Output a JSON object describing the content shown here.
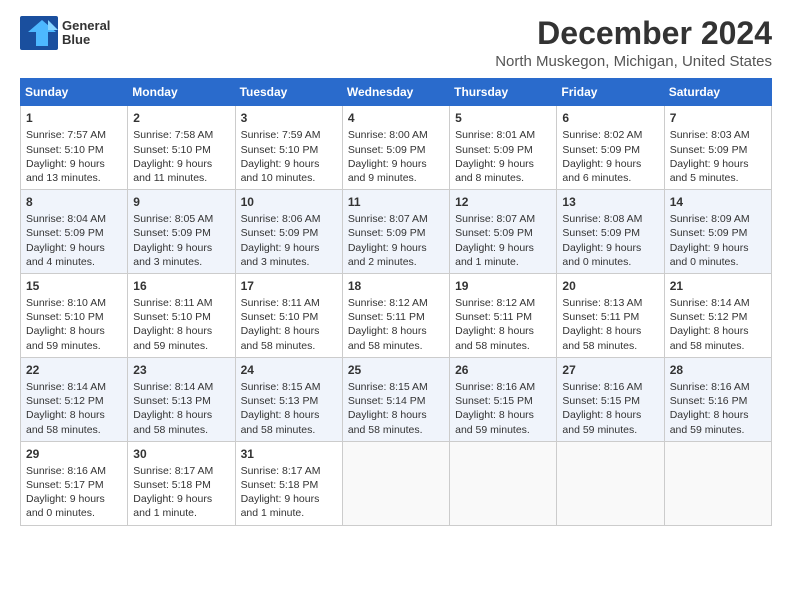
{
  "header": {
    "logo_line1": "General",
    "logo_line2": "Blue",
    "month_title": "December 2024",
    "location": "North Muskegon, Michigan, United States"
  },
  "weekdays": [
    "Sunday",
    "Monday",
    "Tuesday",
    "Wednesday",
    "Thursday",
    "Friday",
    "Saturday"
  ],
  "weeks": [
    [
      {
        "day": "1",
        "lines": [
          "Sunrise: 7:57 AM",
          "Sunset: 5:10 PM",
          "Daylight: 9 hours",
          "and 13 minutes."
        ]
      },
      {
        "day": "2",
        "lines": [
          "Sunrise: 7:58 AM",
          "Sunset: 5:10 PM",
          "Daylight: 9 hours",
          "and 11 minutes."
        ]
      },
      {
        "day": "3",
        "lines": [
          "Sunrise: 7:59 AM",
          "Sunset: 5:10 PM",
          "Daylight: 9 hours",
          "and 10 minutes."
        ]
      },
      {
        "day": "4",
        "lines": [
          "Sunrise: 8:00 AM",
          "Sunset: 5:09 PM",
          "Daylight: 9 hours",
          "and 9 minutes."
        ]
      },
      {
        "day": "5",
        "lines": [
          "Sunrise: 8:01 AM",
          "Sunset: 5:09 PM",
          "Daylight: 9 hours",
          "and 8 minutes."
        ]
      },
      {
        "day": "6",
        "lines": [
          "Sunrise: 8:02 AM",
          "Sunset: 5:09 PM",
          "Daylight: 9 hours",
          "and 6 minutes."
        ]
      },
      {
        "day": "7",
        "lines": [
          "Sunrise: 8:03 AM",
          "Sunset: 5:09 PM",
          "Daylight: 9 hours",
          "and 5 minutes."
        ]
      }
    ],
    [
      {
        "day": "8",
        "lines": [
          "Sunrise: 8:04 AM",
          "Sunset: 5:09 PM",
          "Daylight: 9 hours",
          "and 4 minutes."
        ]
      },
      {
        "day": "9",
        "lines": [
          "Sunrise: 8:05 AM",
          "Sunset: 5:09 PM",
          "Daylight: 9 hours",
          "and 3 minutes."
        ]
      },
      {
        "day": "10",
        "lines": [
          "Sunrise: 8:06 AM",
          "Sunset: 5:09 PM",
          "Daylight: 9 hours",
          "and 3 minutes."
        ]
      },
      {
        "day": "11",
        "lines": [
          "Sunrise: 8:07 AM",
          "Sunset: 5:09 PM",
          "Daylight: 9 hours",
          "and 2 minutes."
        ]
      },
      {
        "day": "12",
        "lines": [
          "Sunrise: 8:07 AM",
          "Sunset: 5:09 PM",
          "Daylight: 9 hours",
          "and 1 minute."
        ]
      },
      {
        "day": "13",
        "lines": [
          "Sunrise: 8:08 AM",
          "Sunset: 5:09 PM",
          "Daylight: 9 hours",
          "and 0 minutes."
        ]
      },
      {
        "day": "14",
        "lines": [
          "Sunrise: 8:09 AM",
          "Sunset: 5:09 PM",
          "Daylight: 9 hours",
          "and 0 minutes."
        ]
      }
    ],
    [
      {
        "day": "15",
        "lines": [
          "Sunrise: 8:10 AM",
          "Sunset: 5:10 PM",
          "Daylight: 8 hours",
          "and 59 minutes."
        ]
      },
      {
        "day": "16",
        "lines": [
          "Sunrise: 8:11 AM",
          "Sunset: 5:10 PM",
          "Daylight: 8 hours",
          "and 59 minutes."
        ]
      },
      {
        "day": "17",
        "lines": [
          "Sunrise: 8:11 AM",
          "Sunset: 5:10 PM",
          "Daylight: 8 hours",
          "and 58 minutes."
        ]
      },
      {
        "day": "18",
        "lines": [
          "Sunrise: 8:12 AM",
          "Sunset: 5:11 PM",
          "Daylight: 8 hours",
          "and 58 minutes."
        ]
      },
      {
        "day": "19",
        "lines": [
          "Sunrise: 8:12 AM",
          "Sunset: 5:11 PM",
          "Daylight: 8 hours",
          "and 58 minutes."
        ]
      },
      {
        "day": "20",
        "lines": [
          "Sunrise: 8:13 AM",
          "Sunset: 5:11 PM",
          "Daylight: 8 hours",
          "and 58 minutes."
        ]
      },
      {
        "day": "21",
        "lines": [
          "Sunrise: 8:14 AM",
          "Sunset: 5:12 PM",
          "Daylight: 8 hours",
          "and 58 minutes."
        ]
      }
    ],
    [
      {
        "day": "22",
        "lines": [
          "Sunrise: 8:14 AM",
          "Sunset: 5:12 PM",
          "Daylight: 8 hours",
          "and 58 minutes."
        ]
      },
      {
        "day": "23",
        "lines": [
          "Sunrise: 8:14 AM",
          "Sunset: 5:13 PM",
          "Daylight: 8 hours",
          "and 58 minutes."
        ]
      },
      {
        "day": "24",
        "lines": [
          "Sunrise: 8:15 AM",
          "Sunset: 5:13 PM",
          "Daylight: 8 hours",
          "and 58 minutes."
        ]
      },
      {
        "day": "25",
        "lines": [
          "Sunrise: 8:15 AM",
          "Sunset: 5:14 PM",
          "Daylight: 8 hours",
          "and 58 minutes."
        ]
      },
      {
        "day": "26",
        "lines": [
          "Sunrise: 8:16 AM",
          "Sunset: 5:15 PM",
          "Daylight: 8 hours",
          "and 59 minutes."
        ]
      },
      {
        "day": "27",
        "lines": [
          "Sunrise: 8:16 AM",
          "Sunset: 5:15 PM",
          "Daylight: 8 hours",
          "and 59 minutes."
        ]
      },
      {
        "day": "28",
        "lines": [
          "Sunrise: 8:16 AM",
          "Sunset: 5:16 PM",
          "Daylight: 8 hours",
          "and 59 minutes."
        ]
      }
    ],
    [
      {
        "day": "29",
        "lines": [
          "Sunrise: 8:16 AM",
          "Sunset: 5:17 PM",
          "Daylight: 9 hours",
          "and 0 minutes."
        ]
      },
      {
        "day": "30",
        "lines": [
          "Sunrise: 8:17 AM",
          "Sunset: 5:18 PM",
          "Daylight: 9 hours",
          "and 1 minute."
        ]
      },
      {
        "day": "31",
        "lines": [
          "Sunrise: 8:17 AM",
          "Sunset: 5:18 PM",
          "Daylight: 9 hours",
          "and 1 minute."
        ]
      },
      null,
      null,
      null,
      null
    ]
  ]
}
